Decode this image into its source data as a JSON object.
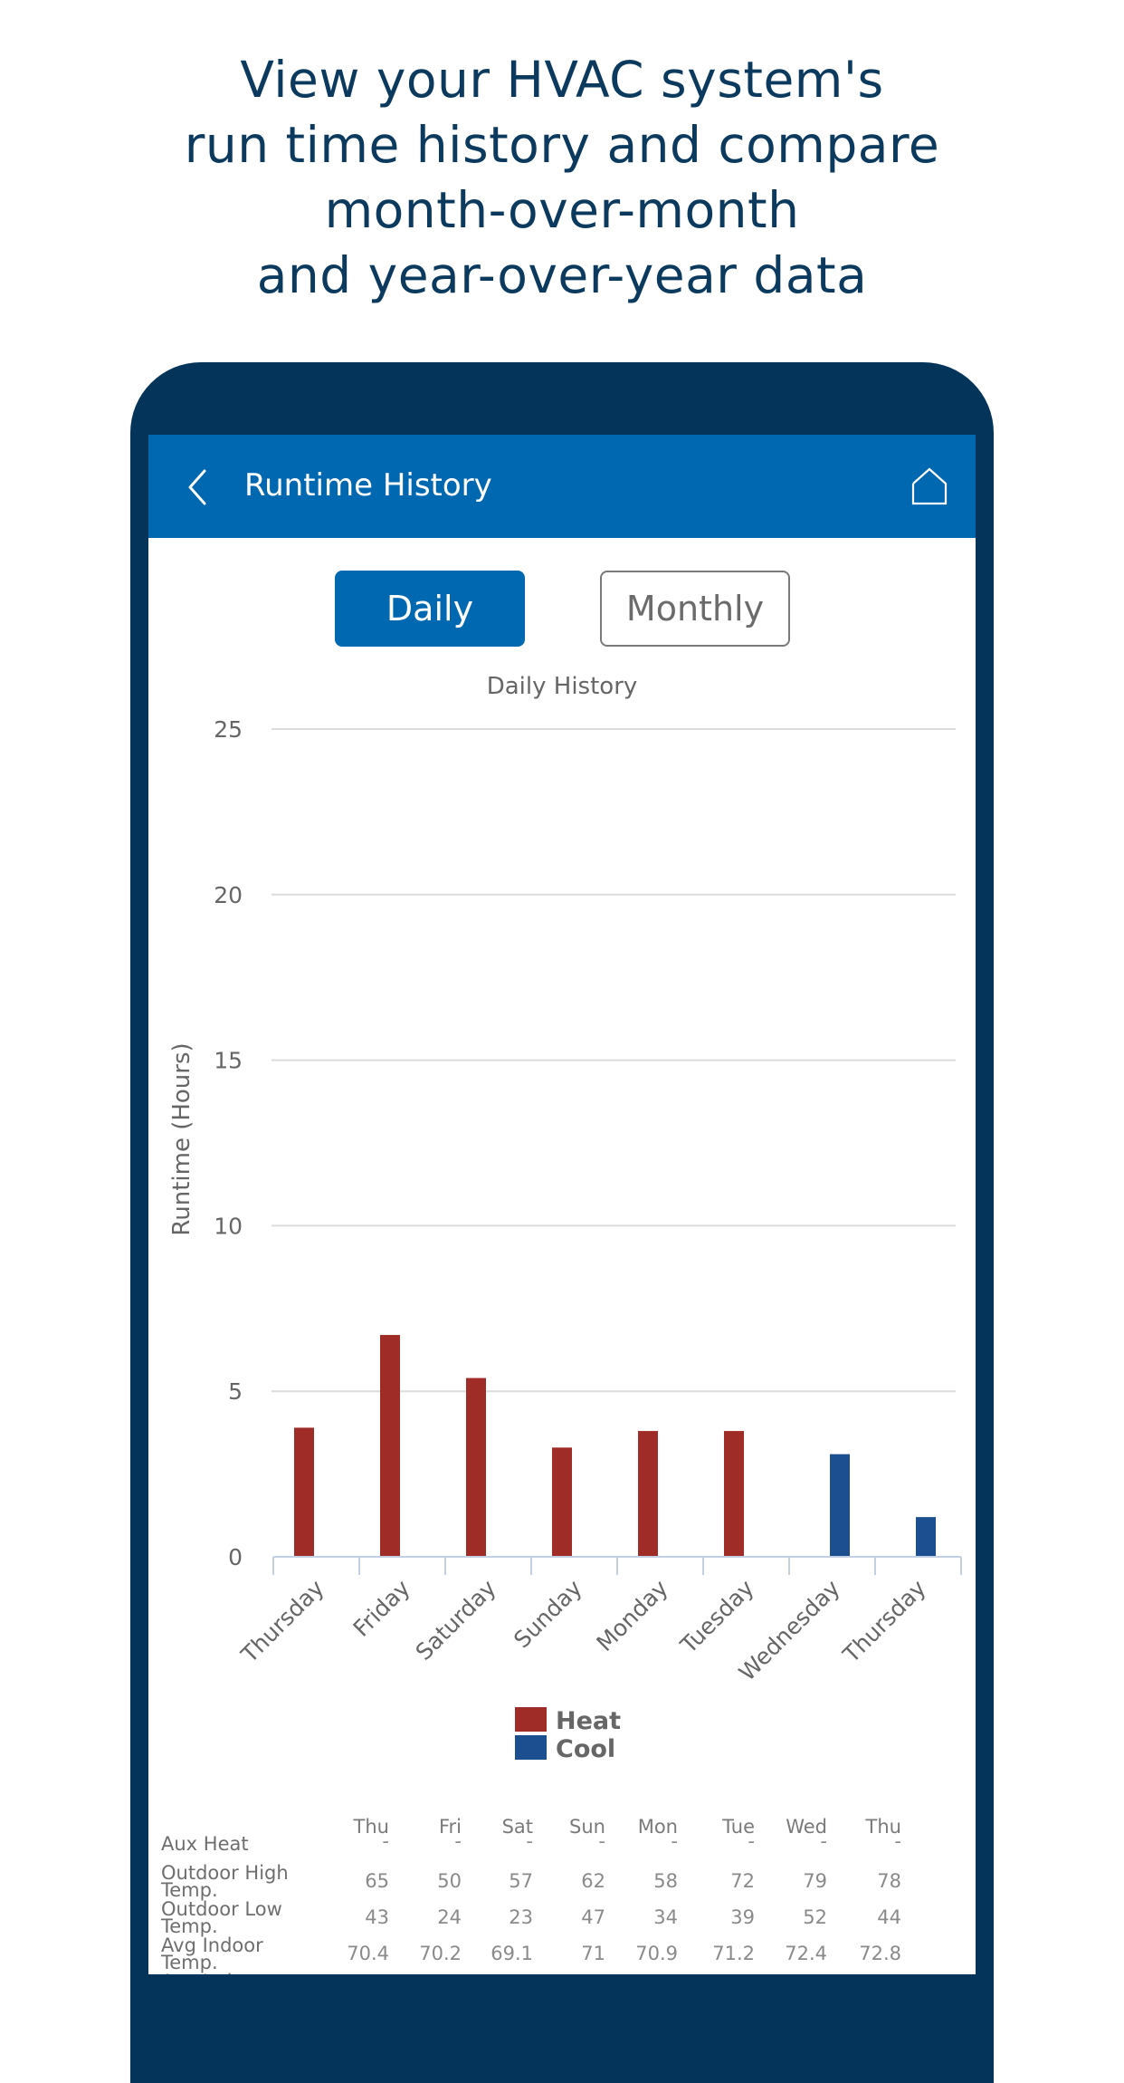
{
  "headline": {
    "lines": [
      "View your HVAC system's",
      "run time history and compare",
      "month-over-month",
      "and year-over-year data"
    ]
  },
  "colors": {
    "frame": "#04345a",
    "app_bar": "#0067b1",
    "heat": "#a02c27",
    "cool": "#1b4f8f",
    "headline": "#0b3a5e"
  },
  "app_bar": {
    "title": "Runtime History",
    "back_icon": "chevron-left-icon",
    "home_icon": "home-icon"
  },
  "segment": {
    "daily_label": "Daily",
    "monthly_label": "Monthly",
    "selected": "Daily"
  },
  "chart_data": {
    "type": "bar",
    "title": "Daily History",
    "xlabel": "",
    "ylabel": "Runtime (Hours)",
    "ylim": [
      0,
      25
    ],
    "yticks": [
      0,
      5,
      10,
      15,
      20,
      25
    ],
    "grid": true,
    "legend_position": "bottom-center",
    "categories": [
      "Thursday",
      "Friday",
      "Saturday",
      "Sunday",
      "Monday",
      "Tuesday",
      "Wednesday",
      "Thursday"
    ],
    "series": [
      {
        "name": "Heat",
        "color": "#a02c27",
        "values": [
          3.9,
          6.7,
          5.4,
          3.3,
          3.8,
          3.8,
          0,
          0
        ]
      },
      {
        "name": "Cool",
        "color": "#1b4f8f",
        "values": [
          0,
          0,
          0,
          0,
          0,
          0,
          3.1,
          1.2
        ]
      }
    ]
  },
  "table": {
    "columns": [
      "Thu",
      "Fri",
      "Sat",
      "Sun",
      "Mon",
      "Tue",
      "Wed",
      "Thu"
    ],
    "rows": [
      {
        "label": "Aux Heat",
        "values": [
          "-",
          "-",
          "-",
          "-",
          "-",
          "-",
          "-",
          "-"
        ]
      },
      {
        "label": "Outdoor High Temp.",
        "values": [
          "65",
          "50",
          "57",
          "62",
          "58",
          "72",
          "79",
          "78"
        ]
      },
      {
        "label": "Outdoor Low Temp.",
        "values": [
          "43",
          "24",
          "23",
          "47",
          "34",
          "39",
          "52",
          "44"
        ]
      },
      {
        "label": "Avg Indoor Temp.",
        "values": [
          "70.4",
          "70.2",
          "69.1",
          "71",
          "70.9",
          "71.2",
          "72.4",
          "72.8"
        ]
      },
      {
        "label": "Avg Indoor",
        "values": [
          "",
          "",
          "",
          "",
          "",
          "",
          "",
          ""
        ]
      }
    ]
  }
}
